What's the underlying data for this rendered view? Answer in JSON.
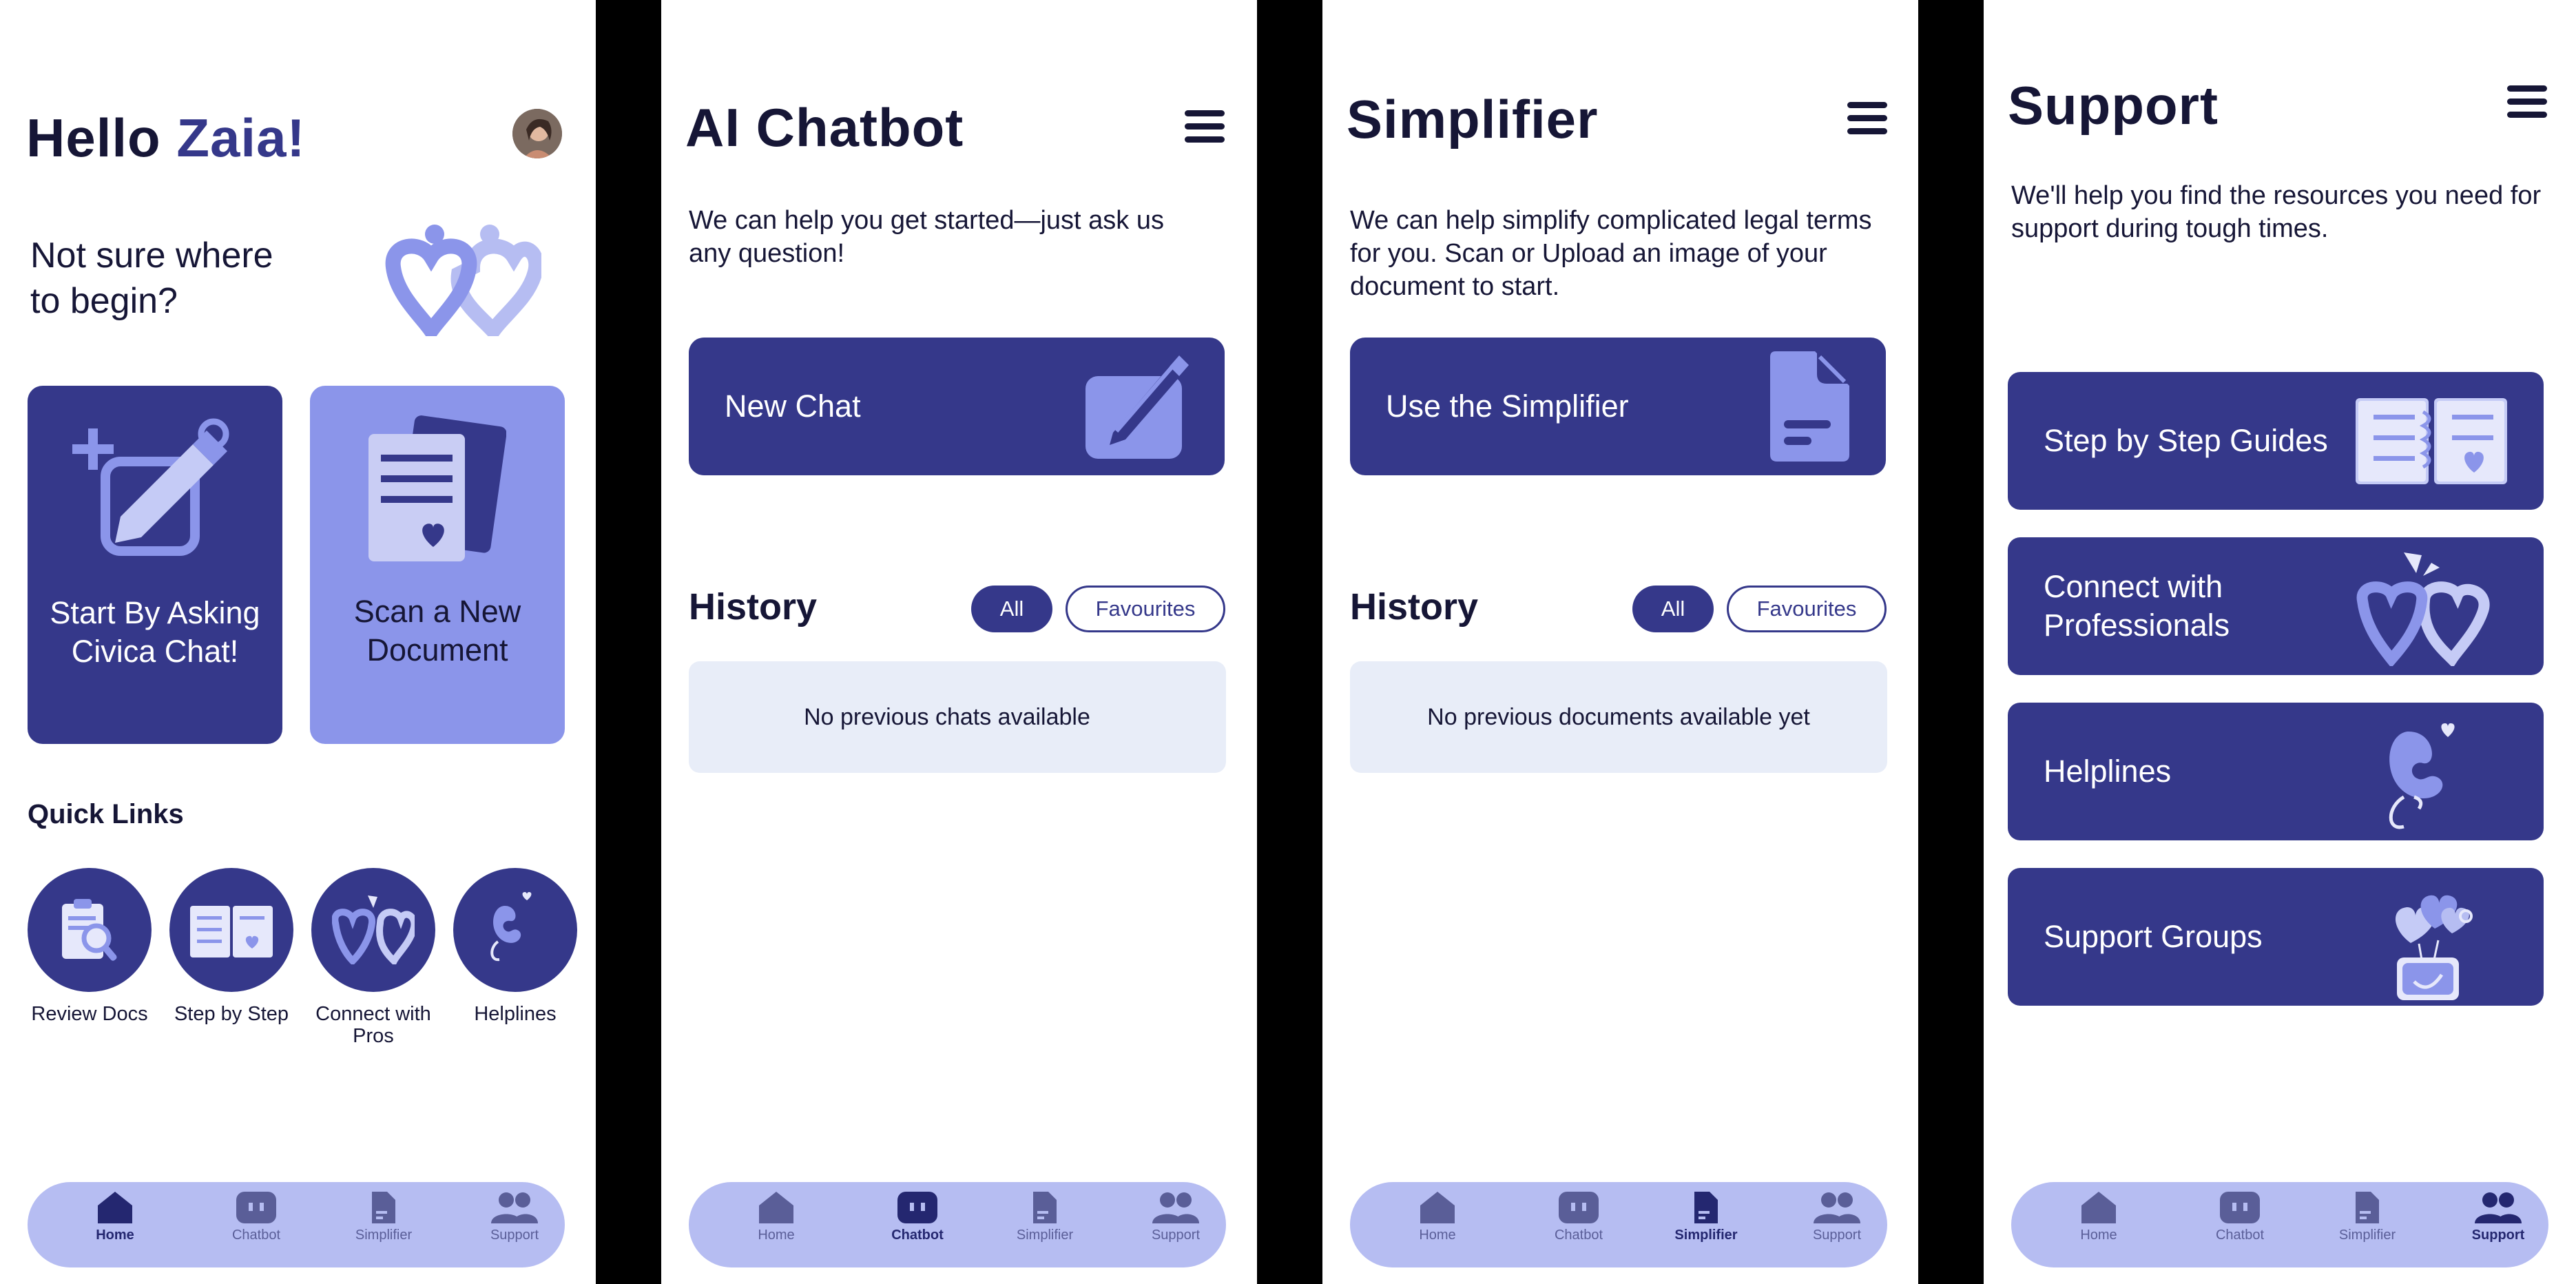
{
  "colors": {
    "primary": "#35388a",
    "light": "#8b95ea",
    "nav": "#b6bdf2",
    "empty": "#e8edf8"
  },
  "nav": {
    "home": "Home",
    "chatbot": "Chatbot",
    "simplifier": "Simplifier",
    "support": "Support"
  },
  "home": {
    "greeting": "Hello ",
    "name": "Zaia!",
    "prompt": "Not sure where to begin?",
    "card_chat": "Start By Asking Civica Chat!",
    "card_scan": "Scan a New Document",
    "quick_links_title": "Quick Links",
    "quick_links": [
      {
        "label": "Review Docs",
        "icon": "review-docs-icon"
      },
      {
        "label": "Step by Step",
        "icon": "guide-book-icon"
      },
      {
        "label": "Connect with Pros",
        "icon": "linked-hearts-icon"
      },
      {
        "label": "Helplines",
        "icon": "phone-heart-icon"
      }
    ]
  },
  "chatbot": {
    "title": "AI Chatbot",
    "description": "We can help you get started—just ask us any question!",
    "new_chat": "New Chat",
    "history_title": "History",
    "filter_all": "All",
    "filter_fav": "Favourites",
    "empty": "No previous chats available"
  },
  "simplifier": {
    "title": "Simplifier",
    "description": "We can help simplify complicated legal terms for you. Scan or Upload an image of your document to start.",
    "use_button": "Use the Simplifier",
    "history_title": "History",
    "filter_all": "All",
    "filter_fav": "Favourites",
    "empty": "No previous documents available yet"
  },
  "support": {
    "title": "Support",
    "description": "We'll help you find the resources you need for support during tough times.",
    "items": [
      {
        "label": "Step by Step Guides",
        "icon": "guide-book-icon"
      },
      {
        "label": "Connect with Professionals",
        "icon": "linked-hearts-icon"
      },
      {
        "label": "Helplines",
        "icon": "phone-heart-icon"
      },
      {
        "label": "Support Groups",
        "icon": "heart-balloons-icon"
      }
    ]
  }
}
